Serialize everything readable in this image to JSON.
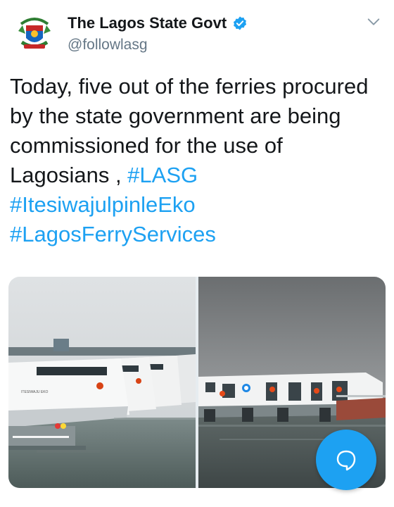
{
  "author": {
    "display_name": "The Lagos State Govt",
    "handle": "@followlasg",
    "verified": true
  },
  "tweet": {
    "text": "Today, five out of the ferries procured by the state government are being commissioned for the use of Lagosians , ",
    "hashtags": [
      "#LASG",
      "#ItesiwajulpinleEko",
      "#LagosFerryServices"
    ]
  },
  "media": {
    "photos": [
      {
        "icon": "ferry-row-photo",
        "hull_label": "ITESIWAJU EKO"
      },
      {
        "icon": "ferry-side-photo"
      }
    ]
  },
  "icons": {
    "menu": "chevron-down-icon",
    "compose": "reply-bubble-icon"
  },
  "colors": {
    "accent": "#1da1f2",
    "text": "#14171a",
    "secondary": "#657786"
  }
}
